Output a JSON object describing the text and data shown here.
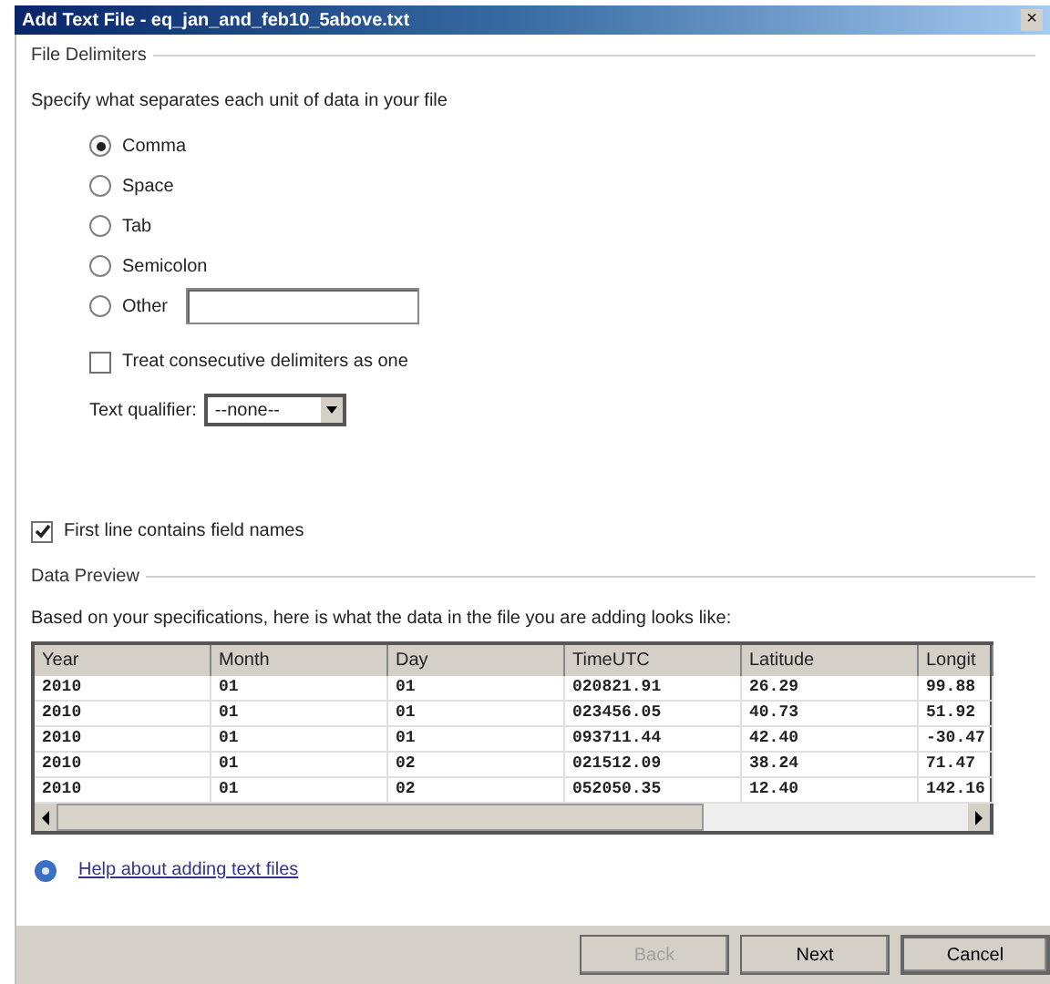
{
  "window": {
    "title": "Add Text File - eq_jan_and_feb10_5above.txt",
    "close": "×"
  },
  "delimiters": {
    "heading": "File Delimiters",
    "instruction": "Specify what separates each unit of data in your file",
    "options": [
      {
        "label": "Comma",
        "selected": true,
        "kind": "radio"
      },
      {
        "label": "Space",
        "selected": false,
        "kind": "radio"
      },
      {
        "label": "Tab",
        "selected": false,
        "kind": "radio"
      },
      {
        "label": "Semicolon",
        "selected": false,
        "kind": "radio"
      },
      {
        "label": "Other",
        "selected": false,
        "kind": "other"
      }
    ],
    "consecutive": {
      "label": "Treat consecutive delimiters as one",
      "checked": false
    },
    "qualifier": {
      "label": "Text qualifier:",
      "value": "--none--"
    }
  },
  "first_line": {
    "label": "First line contains field names",
    "checked": true
  },
  "preview": {
    "heading": "Data Preview",
    "instruction": "Based on your specifications, here is what the data in the file you are adding looks like:",
    "columns": [
      "Year",
      "Month",
      "Day",
      "TimeUTC",
      "Latitude",
      "Longit"
    ],
    "rows": [
      [
        "2010",
        "01",
        "01",
        "020821.91",
        "26.29",
        "99.88"
      ],
      [
        "2010",
        "01",
        "01",
        "023456.05",
        "40.73",
        "51.92"
      ],
      [
        "2010",
        "01",
        "01",
        "093711.44",
        "42.40",
        "-30.47"
      ],
      [
        "2010",
        "01",
        "02",
        "021512.09",
        "38.24",
        "71.47"
      ],
      [
        "2010",
        "01",
        "02",
        "052050.35",
        "12.40",
        "142.16"
      ]
    ]
  },
  "help_link": "Help about adding text files",
  "buttons": [
    {
      "label": "Back",
      "disabled": true
    },
    {
      "label": "Next",
      "disabled": false
    },
    {
      "label": "Cancel",
      "disabled": false
    }
  ]
}
